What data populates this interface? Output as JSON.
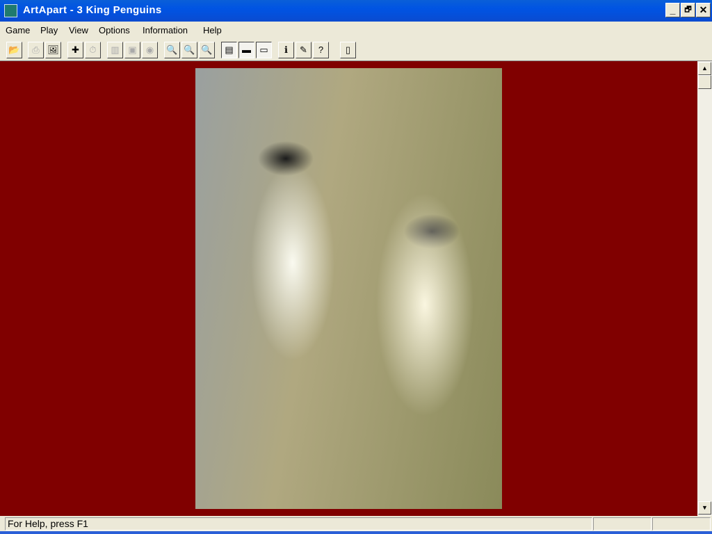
{
  "window": {
    "title": "ArtApart - 3 King Penguins",
    "minimize": "_",
    "restore": "🗗",
    "close": "✕"
  },
  "menu": [
    "Game",
    "Play",
    "View",
    "Options",
    "Information",
    "Help"
  ],
  "toolbar": [
    {
      "icon": "open-icon",
      "glyph": "📂",
      "state": "enabled"
    },
    {
      "icon": "print-icon",
      "glyph": "⎙",
      "state": "disabled"
    },
    {
      "icon": "open-picture-icon",
      "glyph": "🖼",
      "state": "enabled"
    },
    {
      "icon": "puzzle-piece-icon",
      "glyph": "✚",
      "state": "enabled"
    },
    {
      "icon": "timer-icon",
      "glyph": "⏱",
      "state": "disabled"
    },
    {
      "icon": "statistics-icon",
      "glyph": "▥",
      "state": "disabled"
    },
    {
      "icon": "hint-icon",
      "glyph": "▣",
      "state": "disabled"
    },
    {
      "icon": "preview-eye-icon",
      "glyph": "◉",
      "state": "disabled"
    },
    {
      "icon": "zoom-out-icon",
      "glyph": "🔍",
      "state": "disabled"
    },
    {
      "icon": "zoom-in-icon",
      "glyph": "🔍",
      "state": "disabled"
    },
    {
      "icon": "zoom-reset-icon",
      "glyph": "🔍",
      "state": "disabled"
    },
    {
      "icon": "toolbar-toggle-icon",
      "glyph": "▤",
      "state": "pressed"
    },
    {
      "icon": "color-bar-icon",
      "glyph": "▬",
      "state": "pressed"
    },
    {
      "icon": "status-bar-toggle-icon",
      "glyph": "▭",
      "state": "pressed"
    },
    {
      "icon": "picture-info-icon",
      "glyph": "ℹ",
      "state": "enabled"
    },
    {
      "icon": "artist-info-icon",
      "glyph": "✎",
      "state": "enabled"
    },
    {
      "icon": "help-icon",
      "glyph": "?",
      "state": "enabled"
    },
    {
      "icon": "exit-door-icon",
      "glyph": "▯",
      "state": "enabled"
    }
  ],
  "status": {
    "message": "For Help, press F1",
    "pane2": "",
    "pane3": ""
  },
  "colors": {
    "background": "#800000",
    "titlebar": "#0054e3"
  }
}
